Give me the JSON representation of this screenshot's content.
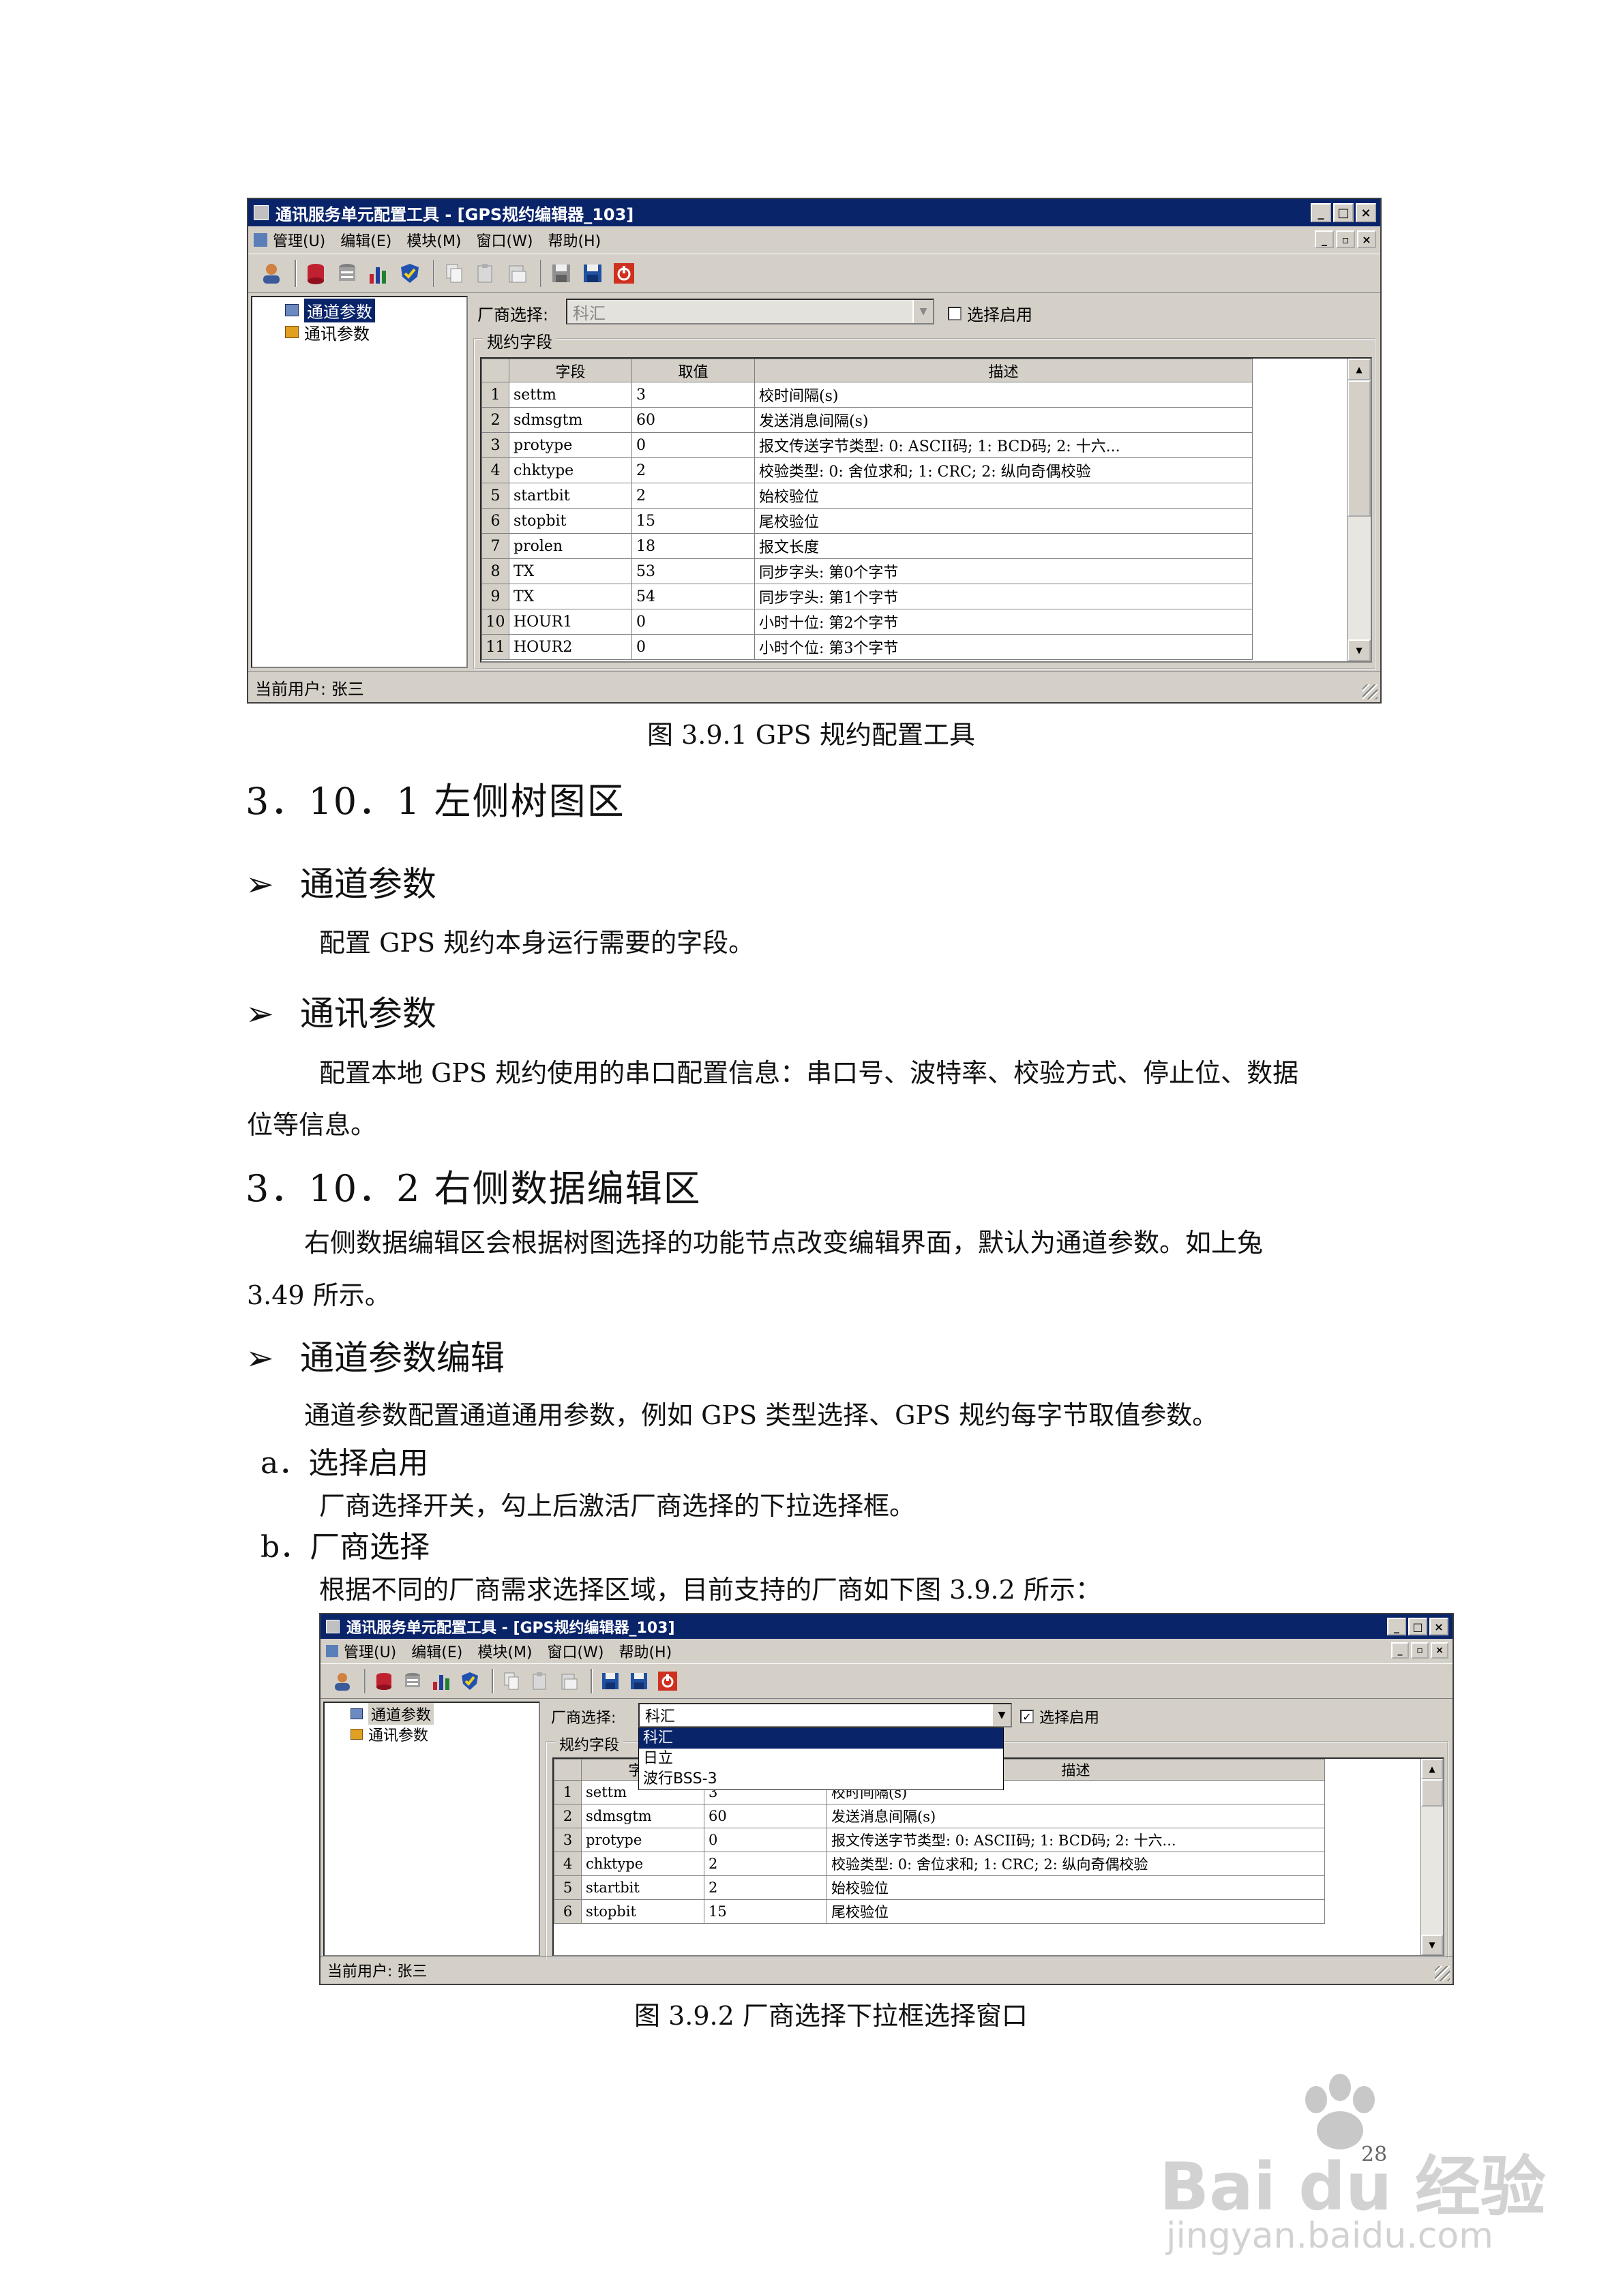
{
  "fig1": {
    "app_title": "通讯服务单元配置工具 - [GPS规约编辑器_103]",
    "caption_buttons": [
      "_",
      "□",
      "×"
    ],
    "mdi_buttons": [
      "_",
      "▫",
      "×"
    ],
    "menu": [
      "管理(U)",
      "编辑(E)",
      "模块(M)",
      "窗口(W)",
      "帮助(H)"
    ],
    "toolbar_icons": [
      "user-icon",
      "database-icon",
      "database-list-icon",
      "chart-icon",
      "shield-check-icon",
      "copy-icon",
      "paste-icon",
      "paste-special-icon",
      "save-icon",
      "save-all-icon",
      "power-icon"
    ],
    "tree": [
      "通道参数",
      "通讯参数"
    ],
    "vendor_label": "厂商选择:",
    "vendor_value": "科汇",
    "enable_label": "选择启用",
    "enable_checked": false,
    "group_label": "规约字段",
    "columns": [
      "字段",
      "取值",
      "描述"
    ],
    "rows": [
      [
        "1",
        "settm",
        "3",
        "校时间隔(s)"
      ],
      [
        "2",
        "sdmsgtm",
        "60",
        "发送消息间隔(s)"
      ],
      [
        "3",
        "protype",
        "0",
        "报文传送字节类型:  0: ASCII码;  1: BCD码;  2: 十六..."
      ],
      [
        "4",
        "chktype",
        "2",
        "校验类型:  0: 舍位求和;  1: CRC;  2: 纵向奇偶校验"
      ],
      [
        "5",
        "startbit",
        "2",
        "始校验位"
      ],
      [
        "6",
        "stopbit",
        "15",
        "尾校验位"
      ],
      [
        "7",
        "prolen",
        "18",
        "报文长度"
      ],
      [
        "8",
        "TX",
        "53",
        "同步字头:  第0个字节"
      ],
      [
        "9",
        "TX",
        "54",
        "同步字头:  第1个字节"
      ],
      [
        "10",
        "HOUR1",
        "0",
        "小时十位:  第2个字节"
      ],
      [
        "11",
        "HOUR2",
        "0",
        "小时个位:  第3个字节"
      ]
    ],
    "status": "当前用户: 张三",
    "caption": "图 3.9.1    GPS 规约配置工具"
  },
  "doc": {
    "h_1": "3．10．1    左侧树图区",
    "b_1": "通道参数",
    "p_1": "配置 GPS 规约本身运行需要的字段。",
    "b_2": "通讯参数",
    "p_2a": "配置本地 GPS 规约使用的串口配置信息：串口号、波特率、校验方式、停止位、数据",
    "p_2b": "位等信息。",
    "h_2": "3．10．2    右侧数据编辑区",
    "p_3a": "右侧数据编辑区会根据树图选择的功能节点改变编辑界面，默认为通道参数。如上兔",
    "p_3b": "3.49 所示。",
    "b_3": "通道参数编辑",
    "p_4": "通道参数配置通道通用参数，例如 GPS 类型选择、GPS 规约每字节取值参数。",
    "sub_a": "a．选择启用",
    "p_5": "厂商选择开关，勾上后激活厂商选择的下拉选择框。",
    "sub_b": "b．厂商选择",
    "p_6": "根据不同的厂商需求选择区域，目前支持的厂商如下图 3.9.2 所示：",
    "bullet_glyph": "➢",
    "page_number": "28"
  },
  "fig2": {
    "app_title": "通讯服务单元配置工具 - [GPS规约编辑器_103]",
    "caption_buttons": [
      "_",
      "□",
      "×"
    ],
    "mdi_buttons": [
      "_",
      "▫",
      "×"
    ],
    "menu": [
      "管理(U)",
      "编辑(E)",
      "模块(M)",
      "窗口(W)",
      "帮助(H)"
    ],
    "tree": [
      "通道参数",
      "通讯参数"
    ],
    "vendor_label": "厂商选择:",
    "vendor_value": "科汇",
    "enable_label": "选择启用",
    "enable_checked": true,
    "dropdown_options": [
      "科汇",
      "日立",
      "波行BSS-3"
    ],
    "group_label": "规约字段",
    "columns": [
      "字段",
      "取值",
      "描述"
    ],
    "rows": [
      [
        "1",
        "settm",
        "3",
        "校时间隔(s)"
      ],
      [
        "2",
        "sdmsgtm",
        "60",
        "发送消息间隔(s)"
      ],
      [
        "3",
        "protype",
        "0",
        "报文传送字节类型:  0: ASCII码;  1: BCD码;  2: 十六..."
      ],
      [
        "4",
        "chktype",
        "2",
        "校验类型:  0: 舍位求和;  1: CRC;  2: 纵向奇偶校验"
      ],
      [
        "5",
        "startbit",
        "2",
        "始校验位"
      ],
      [
        "6",
        "stopbit",
        "15",
        "尾校验位"
      ]
    ],
    "status": "当前用户: 张三",
    "caption": "图 3.9.2    厂商选择下拉框选择窗口"
  },
  "watermark": {
    "brand": "Bai du 经验",
    "url": "jingyan.baidu.com"
  }
}
